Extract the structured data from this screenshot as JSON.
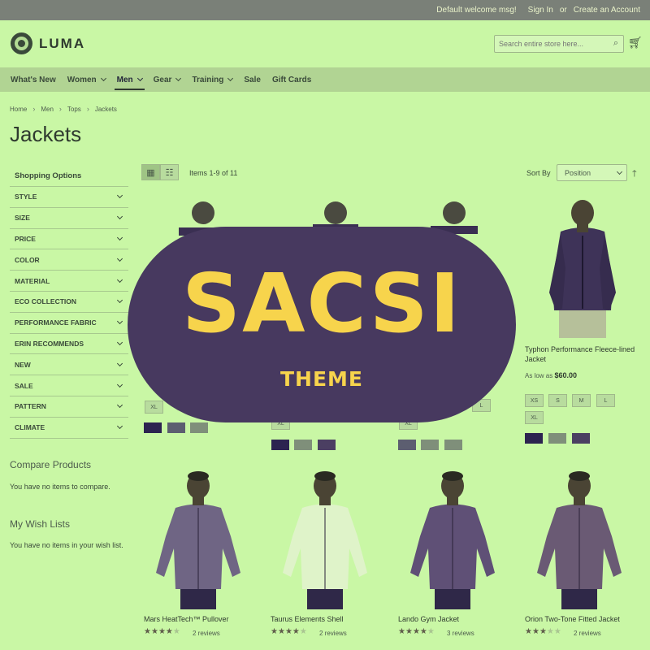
{
  "topbar": {
    "welcome": "Default welcome msg!",
    "sign_in": "Sign In",
    "or": "or",
    "create_account": "Create an Account"
  },
  "header": {
    "logo_text": "LUMA",
    "search_placeholder": "Search entire store here..."
  },
  "nav": [
    {
      "label": "What's New",
      "dropdown": false,
      "active": false
    },
    {
      "label": "Women",
      "dropdown": true,
      "active": false
    },
    {
      "label": "Men",
      "dropdown": true,
      "active": true
    },
    {
      "label": "Gear",
      "dropdown": true,
      "active": false
    },
    {
      "label": "Training",
      "dropdown": true,
      "active": false
    },
    {
      "label": "Sale",
      "dropdown": false,
      "active": false
    },
    {
      "label": "Gift Cards",
      "dropdown": false,
      "active": false
    }
  ],
  "breadcrumb": [
    "Home",
    "Men",
    "Tops",
    "Jackets"
  ],
  "page_title": "Jackets",
  "sidebar": {
    "title": "Shopping Options",
    "filters": [
      "STYLE",
      "SIZE",
      "PRICE",
      "COLOR",
      "MATERIAL",
      "ECO COLLECTION",
      "PERFORMANCE FABRIC",
      "ERIN RECOMMENDS",
      "NEW",
      "SALE",
      "PATTERN",
      "CLIMATE"
    ],
    "compare_title": "Compare Products",
    "compare_text": "You have no items to compare.",
    "wishlist_title": "My Wish Lists",
    "wishlist_text": "You have no items in your wish list."
  },
  "toolbar": {
    "items_count": "Items 1-9 of 11",
    "sort_by_label": "Sort By",
    "sort_value": "Position"
  },
  "overlay": {
    "title": "SACSI",
    "subtitle": "THEME"
  },
  "featured_product": {
    "name": "Typhon Performance Fleece-lined Jacket",
    "price_prefix": "As low as",
    "price": "$60.00",
    "sizes": [
      "XS",
      "S",
      "M",
      "L",
      "XL"
    ]
  },
  "row1_sizes": {
    "col1": "XL",
    "col2": "XL",
    "col3_a": "XL",
    "col3_b": "L"
  },
  "products_row2": [
    {
      "name": "Mars HeatTech™ Pullover",
      "reviews": "2 reviews",
      "rating": 3.5,
      "jacket_color": "#6f6584"
    },
    {
      "name": "Taurus Elements Shell",
      "reviews": "2 reviews",
      "rating": 3.5,
      "jacket_color": "#dff3c9"
    },
    {
      "name": "Lando Gym Jacket",
      "reviews": "3 reviews",
      "rating": 3.5,
      "jacket_color": "#5f5076"
    },
    {
      "name": "Orion Two-Tone Fitted Jacket",
      "reviews": "2 reviews",
      "rating": 2.5,
      "jacket_color": "#6a5a74"
    }
  ],
  "colors": {
    "background": "#c9f7a5",
    "overlay_bg": "#47395f",
    "overlay_text": "#f7d44c",
    "dark_swatch": "#2c2350",
    "gray_swatch": "#7f8f7a",
    "purple_swatch": "#4b3f62"
  }
}
